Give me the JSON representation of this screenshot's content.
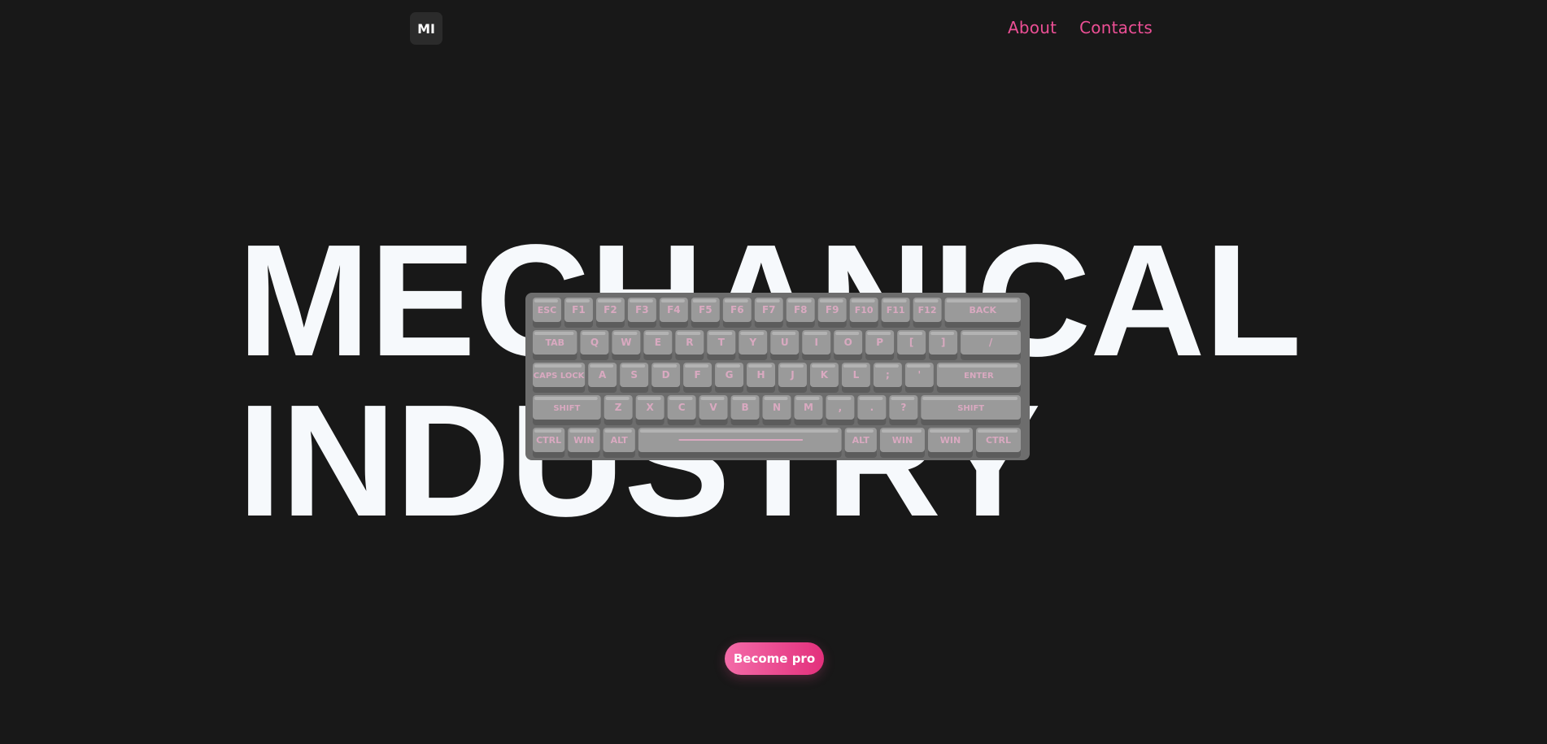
{
  "header": {
    "logo_text": "MI",
    "nav": [
      {
        "label": "About"
      },
      {
        "label": "Contacts"
      }
    ]
  },
  "hero": {
    "line1": "MECHANICAL",
    "line2": "INDUSTRY"
  },
  "keyboard": {
    "rows": [
      [
        "ESC",
        "F1",
        "F2",
        "F3",
        "F4",
        "F5",
        "F6",
        "F7",
        "F8",
        "F9",
        "F10",
        "F11",
        "F12",
        "BACK"
      ],
      [
        "TAB",
        "Q",
        "W",
        "E",
        "R",
        "T",
        "Y",
        "U",
        "I",
        "O",
        "P",
        "[",
        "]",
        "/"
      ],
      [
        "CAPS LOCK",
        "A",
        "S",
        "D",
        "F",
        "G",
        "H",
        "J",
        "K",
        "L",
        ";",
        "'",
        "ENTER"
      ],
      [
        "SHIFT",
        "Z",
        "X",
        "C",
        "V",
        "B",
        "N",
        "M",
        ",",
        ".",
        "?",
        "SHIFT"
      ],
      [
        "CTRL",
        "WIN",
        "ALT",
        "",
        "ALT",
        "WIN",
        "WIN",
        "CTRL"
      ]
    ]
  },
  "cta": {
    "label": "Become pro"
  },
  "colors": {
    "background": "#181818",
    "accent": "#ec4f95",
    "hero_text": "#f6f9fc",
    "keycap": "#9a9a9a",
    "legend": "#d9a9c0"
  }
}
